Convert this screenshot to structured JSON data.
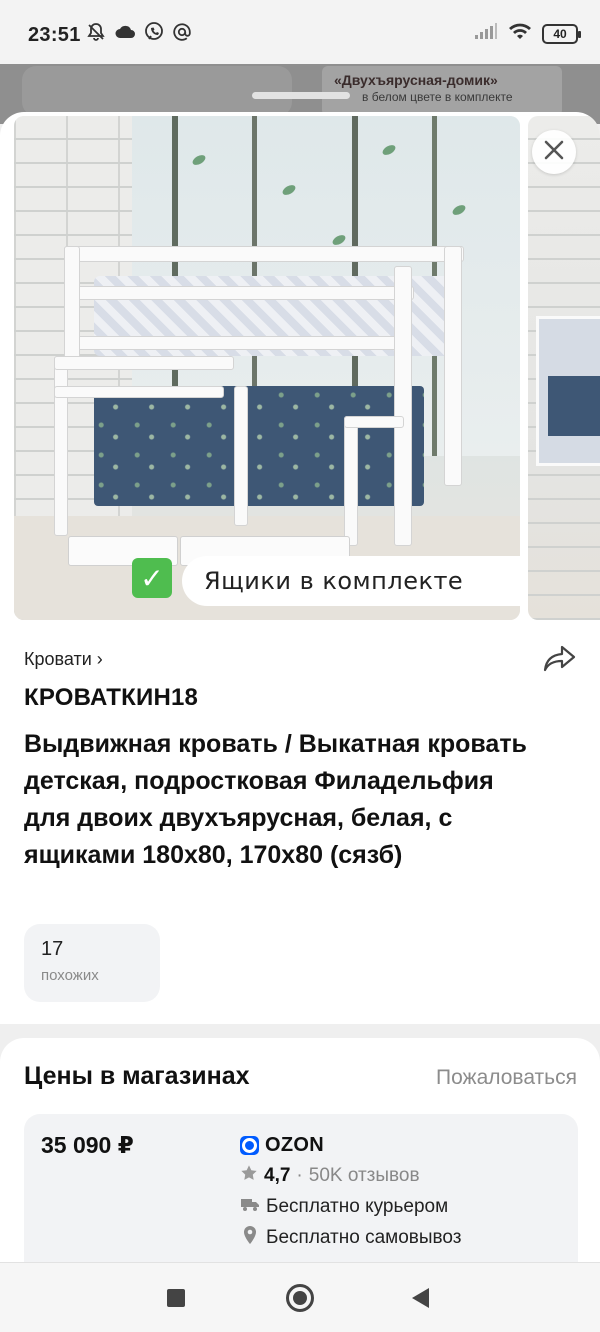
{
  "status_bar": {
    "time": "23:51",
    "battery": "40",
    "left_icons": [
      "bell-off-icon",
      "cloud-icon",
      "viber-icon",
      "at-icon"
    ],
    "right_icons": [
      "signal-icon",
      "wifi-icon",
      "battery-icon"
    ]
  },
  "background": {
    "card_title": "«Двухъярусная-домик»",
    "card_subtitle": "в белом цвете в комплекте"
  },
  "gallery": {
    "caption": "Ящики в комплекте",
    "check_icon": "✓"
  },
  "product": {
    "breadcrumb": "Кровати ›",
    "brand": "КРОВАТКИН18",
    "title": "Выдвижная кровать / Выкатная кровать детская, подростковая Филадельфия для двоих двухъярусная, белая, с ящиками 180х80, 170х80 (сязб)",
    "similar_count": "17",
    "similar_label": "похожих"
  },
  "prices": {
    "title": "Цены в магазинах",
    "complain_label": "Пожаловаться",
    "offers": [
      {
        "price": "35 090 ₽",
        "shop": "OZON",
        "rating": "4,7",
        "separator": "·",
        "reviews": "50K отзывов",
        "delivery": "Бесплатно курьером",
        "pickup": "Бесплатно самовывоз"
      }
    ]
  },
  "colors": {
    "ozon_blue": "#005bff",
    "check_green": "#4fbd4f",
    "muted_text": "#8c8c8c"
  }
}
